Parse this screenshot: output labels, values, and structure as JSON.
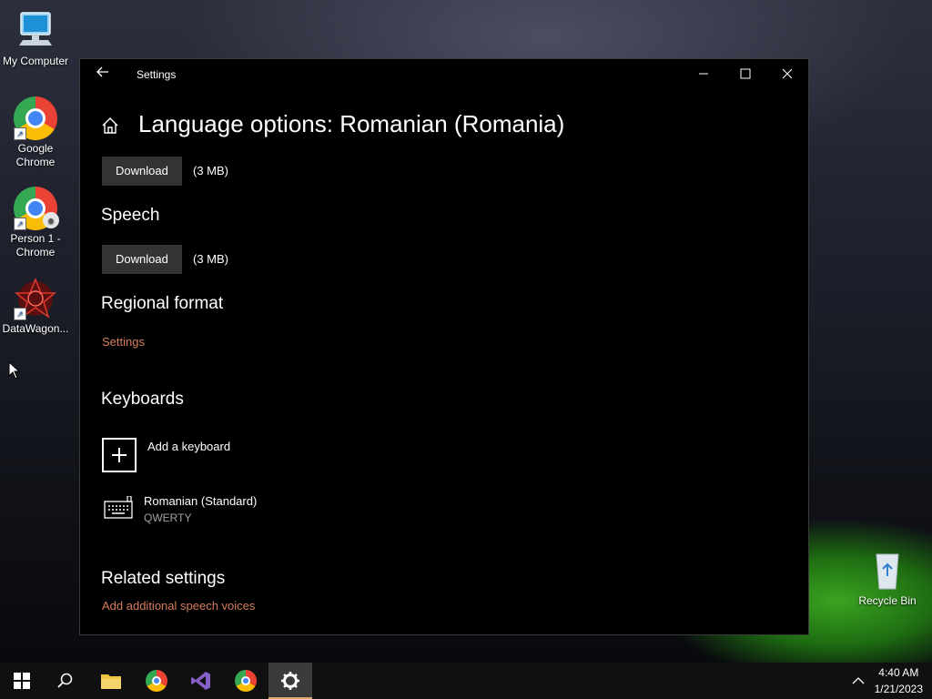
{
  "desktop": {
    "icons": [
      {
        "label": "My Computer"
      },
      {
        "label": "Google Chrome"
      },
      {
        "label": "Person 1 - Chrome"
      },
      {
        "label": "DataWagon..."
      },
      {
        "label": "Recycle Bin"
      }
    ]
  },
  "window": {
    "title": "Settings",
    "page_title": "Language options: Romanian (Romania)",
    "language_pack": {
      "download_label": "Download",
      "size": "(3 MB)"
    },
    "speech": {
      "heading": "Speech",
      "download_label": "Download",
      "size": "(3 MB)"
    },
    "regional_format": {
      "heading": "Regional format",
      "link": "Settings"
    },
    "keyboards": {
      "heading": "Keyboards",
      "add_label": "Add a keyboard",
      "items": [
        {
          "name": "Romanian (Standard)",
          "layout": "QWERTY"
        }
      ]
    },
    "related": {
      "heading": "Related settings",
      "link": "Add additional speech voices"
    }
  },
  "taskbar": {
    "time": "4:40 AM",
    "date": "1/21/2023"
  },
  "colors": {
    "accent_link": "#d57b5a",
    "button_bg": "#333333"
  }
}
